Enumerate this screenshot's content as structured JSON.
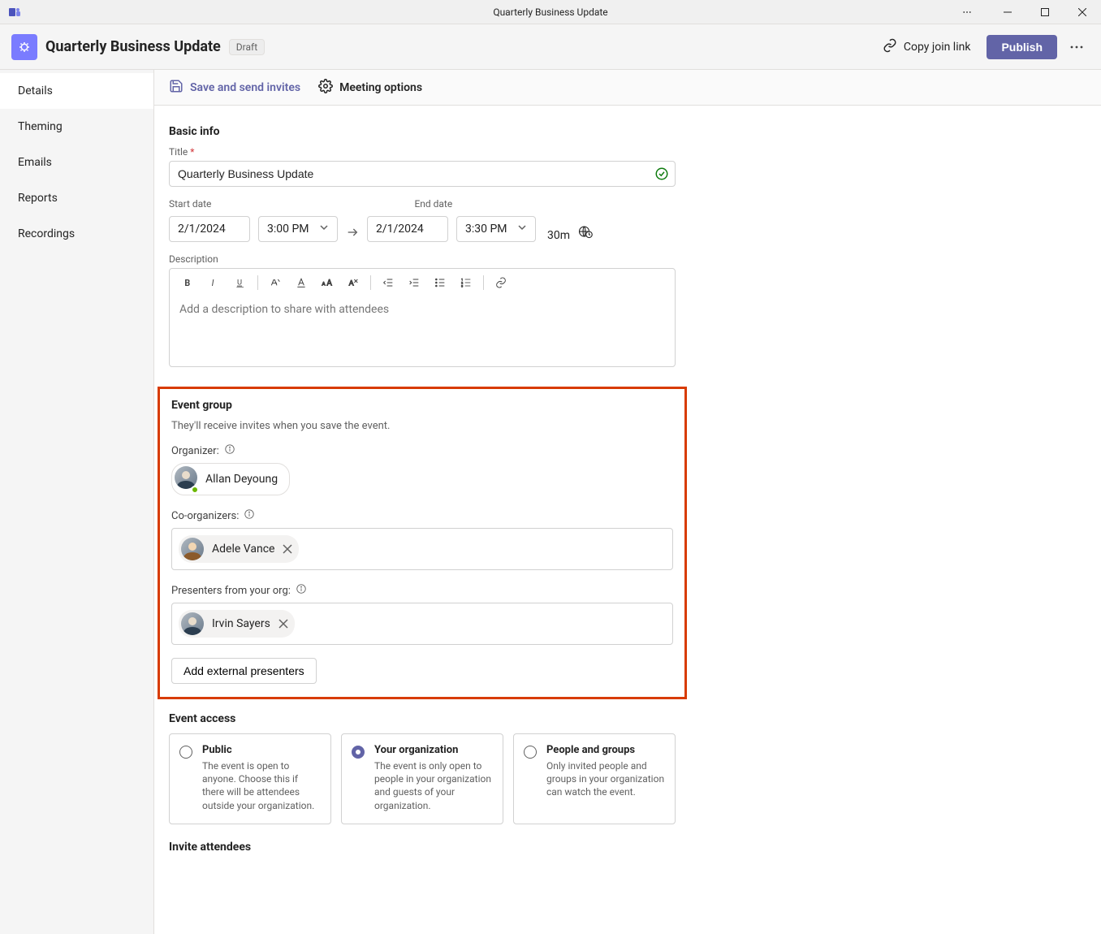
{
  "window": {
    "title": "Quarterly Business Update"
  },
  "header": {
    "meeting_title": "Quarterly Business Update",
    "draft_label": "Draft",
    "copy_link_label": "Copy join link",
    "publish_label": "Publish"
  },
  "sidebar": {
    "items": [
      {
        "label": "Details",
        "active": true
      },
      {
        "label": "Theming",
        "active": false
      },
      {
        "label": "Emails",
        "active": false
      },
      {
        "label": "Reports",
        "active": false
      },
      {
        "label": "Recordings",
        "active": false
      }
    ]
  },
  "actionbar": {
    "save_send_label": "Save and send invites",
    "meeting_options_label": "Meeting options"
  },
  "basic_info": {
    "section_title": "Basic info",
    "title_label": "Title",
    "title_required": "*",
    "title_value": "Quarterly Business Update",
    "start_label": "Start date",
    "end_label": "End date",
    "start_date": "2/1/2024",
    "start_time": "3:00 PM",
    "end_date": "2/1/2024",
    "end_time": "3:30 PM",
    "duration": "30m",
    "description_label": "Description",
    "description_placeholder": "Add a description to share with attendees"
  },
  "event_group": {
    "section_title": "Event group",
    "subdesc": "They'll receive invites when you save the event.",
    "organizer_label": "Organizer:",
    "organizer_name": "Allan Deyoung",
    "coorganizers_label": "Co-organizers:",
    "coorganizers": [
      {
        "name": "Adele Vance"
      }
    ],
    "presenters_label": "Presenters from your org:",
    "presenters": [
      {
        "name": "Irvin Sayers"
      }
    ],
    "add_external_label": "Add external presenters"
  },
  "event_access": {
    "section_title": "Event access",
    "options": [
      {
        "title": "Public",
        "desc": "The event is open to anyone. Choose this if there will be attendees outside your organization.",
        "selected": false
      },
      {
        "title": "Your organization",
        "desc": "The event is only open to people in your organization and guests of your organization.",
        "selected": true
      },
      {
        "title": "People and groups",
        "desc": "Only invited people and groups in your organization can watch the event.",
        "selected": false
      }
    ]
  },
  "invite_attendees": {
    "section_title": "Invite attendees"
  }
}
